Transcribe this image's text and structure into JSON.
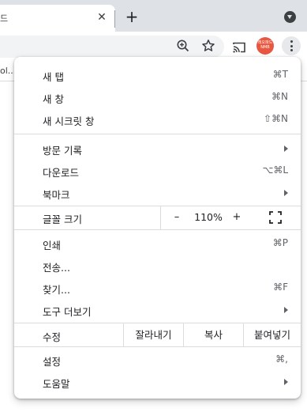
{
  "tab": {
    "title": "드",
    "close": "✕",
    "new_tab": "+"
  },
  "bookmarks_bar": {
    "partial_text": "ol..."
  },
  "avatar": {
    "line1": "레오파드",
    "line2": "NMB"
  },
  "menu": {
    "group1": [
      {
        "label": "새 탭",
        "shortcut": "⌘T"
      },
      {
        "label": "새 창",
        "shortcut": "⌘N"
      },
      {
        "label": "새 시크릿 창",
        "shortcut": "⇧⌘N"
      }
    ],
    "group2": [
      {
        "label": "방문 기록",
        "shortcut": ""
      },
      {
        "label": "다운로드",
        "shortcut": "⌥⌘L"
      },
      {
        "label": "북마크",
        "shortcut": ""
      }
    ],
    "zoom": {
      "label": "글꼴 크기",
      "minus": "–",
      "value": "110%",
      "plus": "+"
    },
    "group3": [
      {
        "label": "인쇄",
        "shortcut": "⌘P"
      },
      {
        "label": "전송...",
        "shortcut": ""
      },
      {
        "label": "찾기...",
        "shortcut": "⌘F"
      },
      {
        "label": "도구 더보기",
        "shortcut": ""
      }
    ],
    "edit": {
      "label": "수정",
      "cut": "잘라내기",
      "copy": "복사",
      "paste": "붙여넣기"
    },
    "group4": [
      {
        "label": "설정",
        "shortcut": "⌘,"
      },
      {
        "label": "도움말",
        "shortcut": ""
      }
    ]
  },
  "colors": {
    "tabstrip": "#dee1e6",
    "avatar": "#e8573f",
    "separator": "#dadce0"
  }
}
